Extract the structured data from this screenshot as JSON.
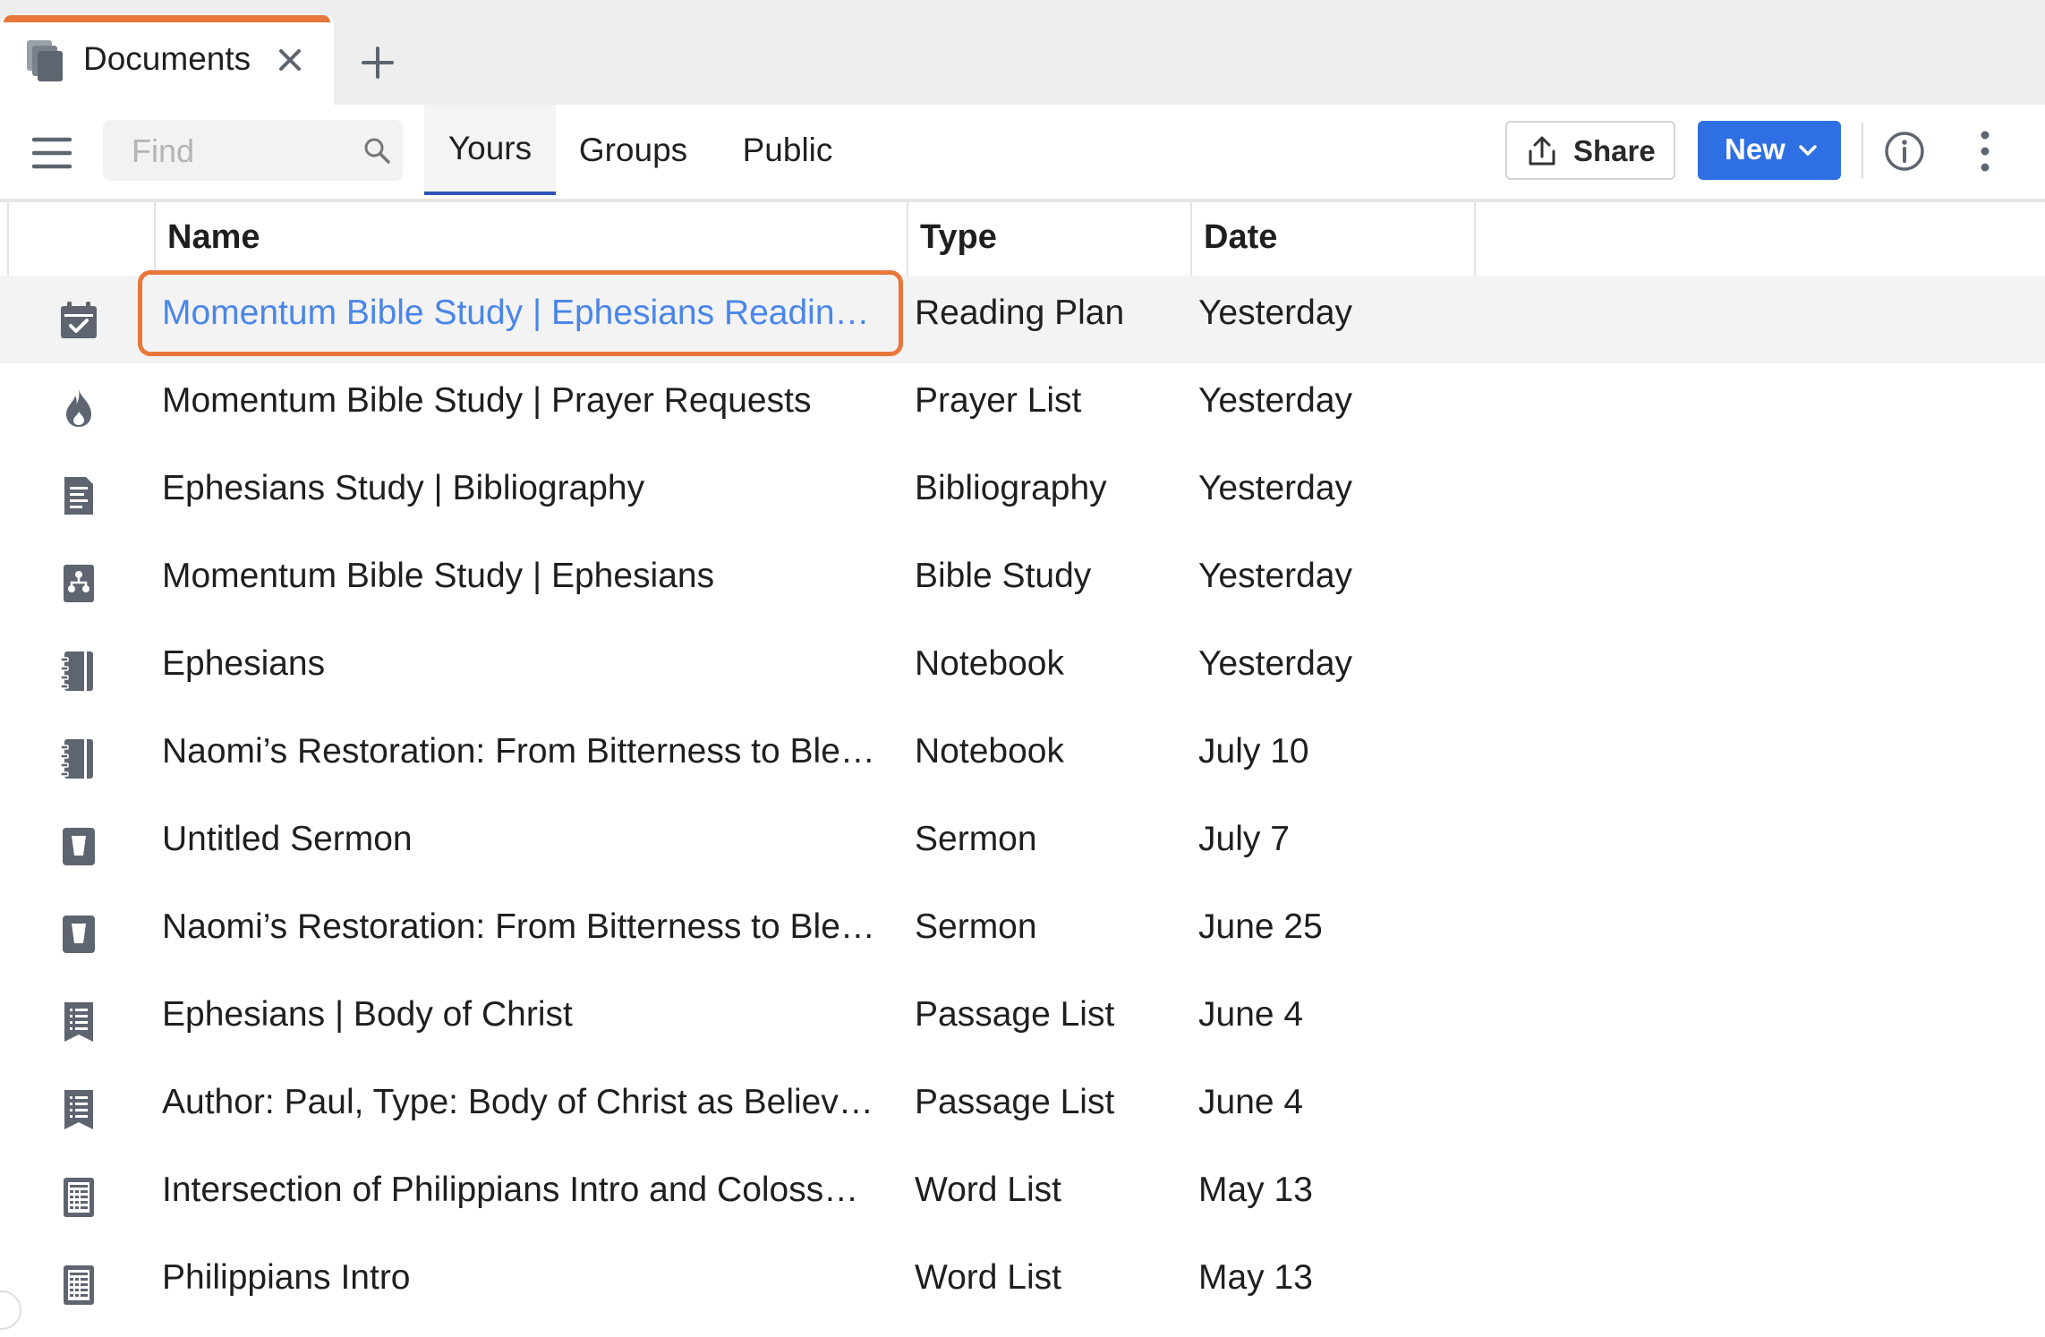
{
  "tab": {
    "title": "Documents"
  },
  "toolbar": {
    "search_placeholder": "Find",
    "scopes": [
      "Yours",
      "Groups",
      "Public"
    ],
    "active_scope": "Yours",
    "share_label": "Share",
    "new_label": "New"
  },
  "table": {
    "columns": {
      "name": "Name",
      "type": "Type",
      "date": "Date"
    },
    "rows": [
      {
        "icon": "calendar-check-icon",
        "name": "Momentum Bible Study | Ephesians Readin…",
        "type": "Reading Plan",
        "date": "Yesterday",
        "selected": true
      },
      {
        "icon": "flame-icon",
        "name": "Momentum Bible Study | Prayer Requests",
        "type": "Prayer List",
        "date": "Yesterday"
      },
      {
        "icon": "document-lines-icon",
        "name": "Ephesians Study | Bibliography",
        "type": "Bibliography",
        "date": "Yesterday"
      },
      {
        "icon": "study-tree-icon",
        "name": "Momentum Bible Study | Ephesians",
        "type": "Bible Study",
        "date": "Yesterday"
      },
      {
        "icon": "notebook-icon",
        "name": "Ephesians",
        "type": "Notebook",
        "date": "Yesterday"
      },
      {
        "icon": "notebook-icon",
        "name": "Naomi’s Restoration: From Bitterness to Ble…",
        "type": "Notebook",
        "date": "July 10"
      },
      {
        "icon": "sermon-icon",
        "name": "Untitled Sermon",
        "type": "Sermon",
        "date": "July 7"
      },
      {
        "icon": "sermon-icon",
        "name": "Naomi’s Restoration: From Bitterness to Ble…",
        "type": "Sermon",
        "date": "June 25"
      },
      {
        "icon": "passage-list-icon",
        "name": "Ephesians | Body of Christ",
        "type": "Passage List",
        "date": "June 4"
      },
      {
        "icon": "passage-list-icon",
        "name": "Author: Paul, Type: Body of Christ as Believ…",
        "type": "Passage List",
        "date": "June 4"
      },
      {
        "icon": "word-list-icon",
        "name": "Intersection of Philippians Intro and Coloss…",
        "type": "Word List",
        "date": "May 13"
      },
      {
        "icon": "word-list-icon",
        "name": "Philippians Intro",
        "type": "Word List",
        "date": "May 13"
      }
    ]
  },
  "colors": {
    "accent_orange": "#e8773a",
    "primary_blue": "#2f6fe4",
    "link_blue": "#4a86e8",
    "tab_underline": "#2f55b8",
    "icon_gray": "#5e6470"
  }
}
